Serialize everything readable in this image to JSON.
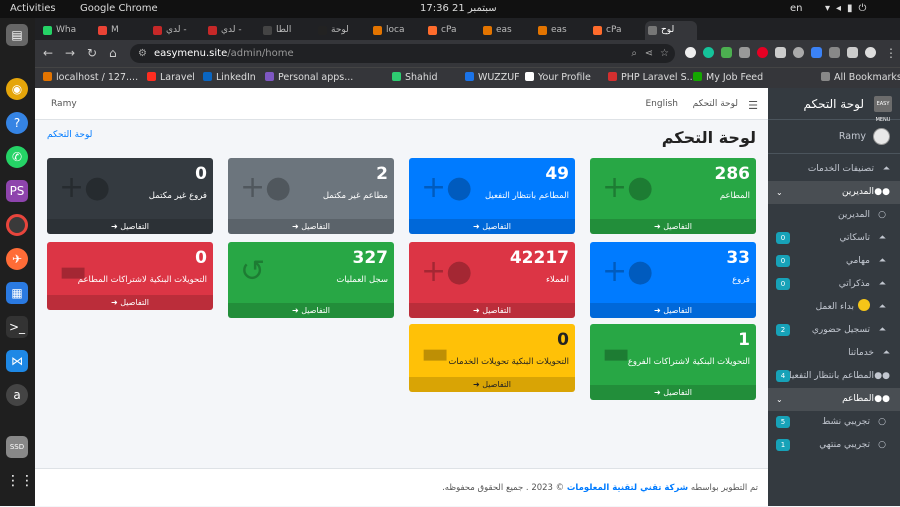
{
  "os": {
    "activities": "Activities",
    "app": "Google Chrome",
    "clock": "17:36  21 سبتمبر",
    "lang": "en"
  },
  "browser": {
    "tabs": [
      {
        "label": "Wha",
        "color": "#25d366"
      },
      {
        "label": "M",
        "color": "#ea4335"
      },
      {
        "label": "لدي -",
        "color": "#c62828"
      },
      {
        "label": "لدي -",
        "color": "#c62828"
      },
      {
        "label": "الطا",
        "color": "#444"
      },
      {
        "label": "لوحة",
        "color": "#222"
      },
      {
        "label": "loca",
        "color": "#e37400"
      },
      {
        "label": "cPa",
        "color": "#ff6c2c"
      },
      {
        "label": "eas",
        "color": "#e37400"
      },
      {
        "label": "eas",
        "color": "#e37400"
      },
      {
        "label": "cPa",
        "color": "#ff6c2c"
      },
      {
        "label": "لوح",
        "color": "#777"
      }
    ],
    "url_host": "easymenu.site",
    "url_path": "/admin/home",
    "bookmarks": [
      "localhost / 127....",
      "Laravel",
      "LinkedIn",
      "Personal apps...",
      "Shahid",
      "WUZZUF",
      "Your Profile",
      "PHP Laravel S...",
      "My Job Feed",
      "All Bookmarks"
    ]
  },
  "sidebar": {
    "brand": "لوحة التحكم",
    "logo_text": "EASY MENU",
    "user": "Ramy",
    "items": [
      {
        "label": "تصنيفات الخدمات",
        "icon": "bell-icon"
      },
      {
        "label": "المديرين",
        "icon": "users-icon"
      },
      {
        "label": "المديرين",
        "icon": "circle-icon"
      },
      {
        "label": "تاسكاتي",
        "icon": "bell-icon",
        "badge": "0"
      },
      {
        "label": "مهامي",
        "icon": "bell-icon",
        "badge": "0"
      },
      {
        "label": "مذكراتي",
        "icon": "bell-icon",
        "badge": "0"
      },
      {
        "label": "بداء العمل",
        "icon": "bell-icon"
      },
      {
        "label": "تسجيل حضوري",
        "icon": "bell-icon",
        "badge": "2"
      },
      {
        "label": "خدماتنا",
        "icon": "bell-icon"
      },
      {
        "label": "المطاعم بانتظار التفعيل",
        "icon": "users-icon",
        "badge": "4"
      },
      {
        "label": "المطاعم",
        "icon": "users-icon"
      },
      {
        "label": "تجريبي نشط",
        "icon": "circle-icon",
        "badge": "5"
      },
      {
        "label": "تجريبي منتهي",
        "icon": "circle-icon",
        "badge": "1"
      }
    ]
  },
  "topnav": {
    "home": "لوحة التحكم",
    "lang": "English",
    "user": "Ramy"
  },
  "page": {
    "title": "لوحة التحكم",
    "breadcrumb": "لوحة التحكم"
  },
  "boxes": [
    {
      "value": "286",
      "label": "المطاعم",
      "footer": "التفاصيل",
      "color": "#28a745",
      "icon": "user-plus-icon"
    },
    {
      "value": "49",
      "label": "المطاعم بانتظار التفعيل",
      "footer": "التفاصيل",
      "color": "#007bff",
      "icon": "user-plus-icon"
    },
    {
      "value": "2",
      "label": "مطاعم غير مكتمل",
      "footer": "التفاصيل",
      "color": "#6c757d",
      "icon": "user-plus-icon"
    },
    {
      "value": "0",
      "label": "فروع غير مكتمل",
      "footer": "التفاصيل",
      "color": "#343a40",
      "icon": "user-plus-icon"
    },
    {
      "value": "33",
      "label": "فروع",
      "footer": "التفاصيل",
      "color": "#007bff",
      "icon": "user-plus-icon"
    },
    {
      "value": "42217",
      "label": "العملاء",
      "footer": "التفاصيل",
      "color": "#dc3545",
      "icon": "user-plus-icon"
    },
    {
      "value": "327",
      "label": "سجل العمليات",
      "footer": "التفاصيل",
      "color": "#28a745",
      "icon": "history-icon"
    },
    {
      "value": "0",
      "label": "التحويلات البنكية لاشتراكات المطاعم",
      "footer": "التفاصيل",
      "color": "#dc3545",
      "icon": "money-icon"
    },
    {
      "value": "1",
      "label": "التحويلات البنكية لاشتراكات الفروع",
      "footer": "التفاصيل",
      "color": "#28a745",
      "icon": "money-icon"
    },
    {
      "value": "0",
      "label": "التحويلات البنكية تحويلات الخدمات",
      "footer": "التفاصيل",
      "color": "#ffc107",
      "icon": "money-icon"
    }
  ],
  "footer": {
    "prefix": "تم التطوير بواسطه",
    "company": "شركة تقني لتقنية المعلومات",
    "rest": "© 2023 . جميع الحقوق محفوظه."
  }
}
